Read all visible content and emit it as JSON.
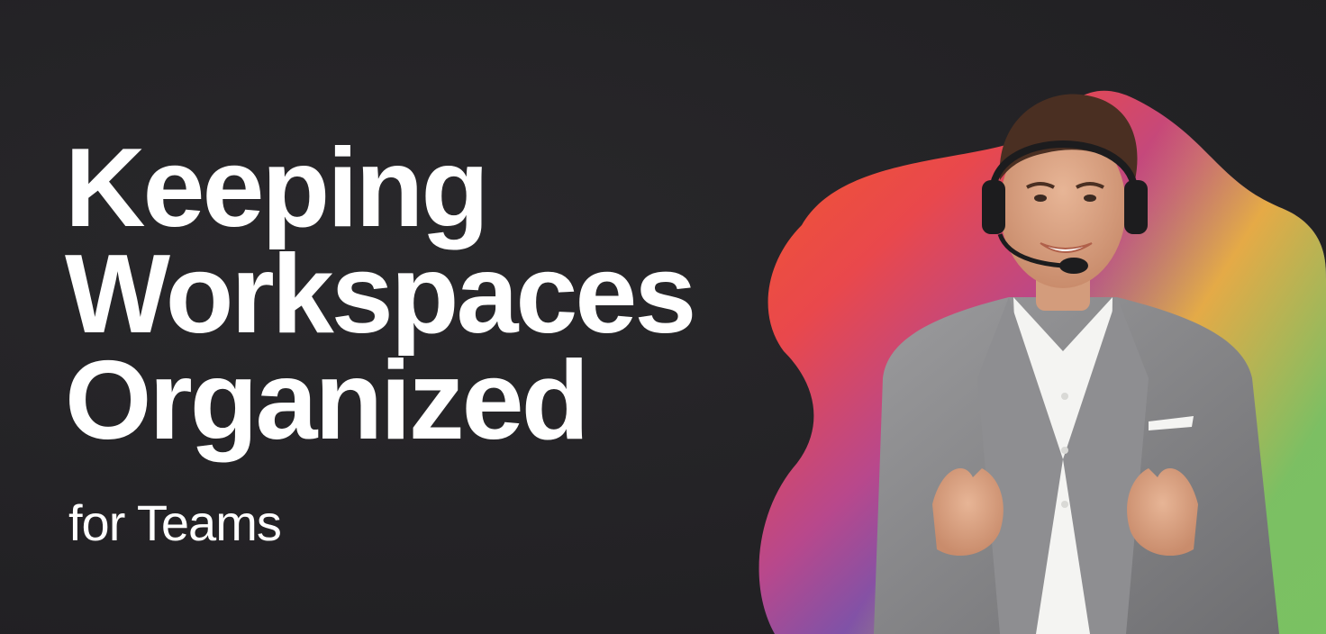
{
  "headline": {
    "line1": "Keeping",
    "line2": "Workspaces",
    "line3": "Organized"
  },
  "subheadline": "for Teams",
  "colors": {
    "background": "#232225",
    "text": "#ffffff",
    "blob_gradient": [
      "#f0552e",
      "#e94a4a",
      "#c04a86",
      "#6a55b0",
      "#3d6fc4",
      "#2aa0b8",
      "#7cc060",
      "#f2b23a"
    ],
    "suit": "#8a8a8c",
    "shirt": "#f4f4f2"
  },
  "photo": {
    "subject": "smiling man wearing a headset and gray suit jacket, hands on lapels"
  }
}
